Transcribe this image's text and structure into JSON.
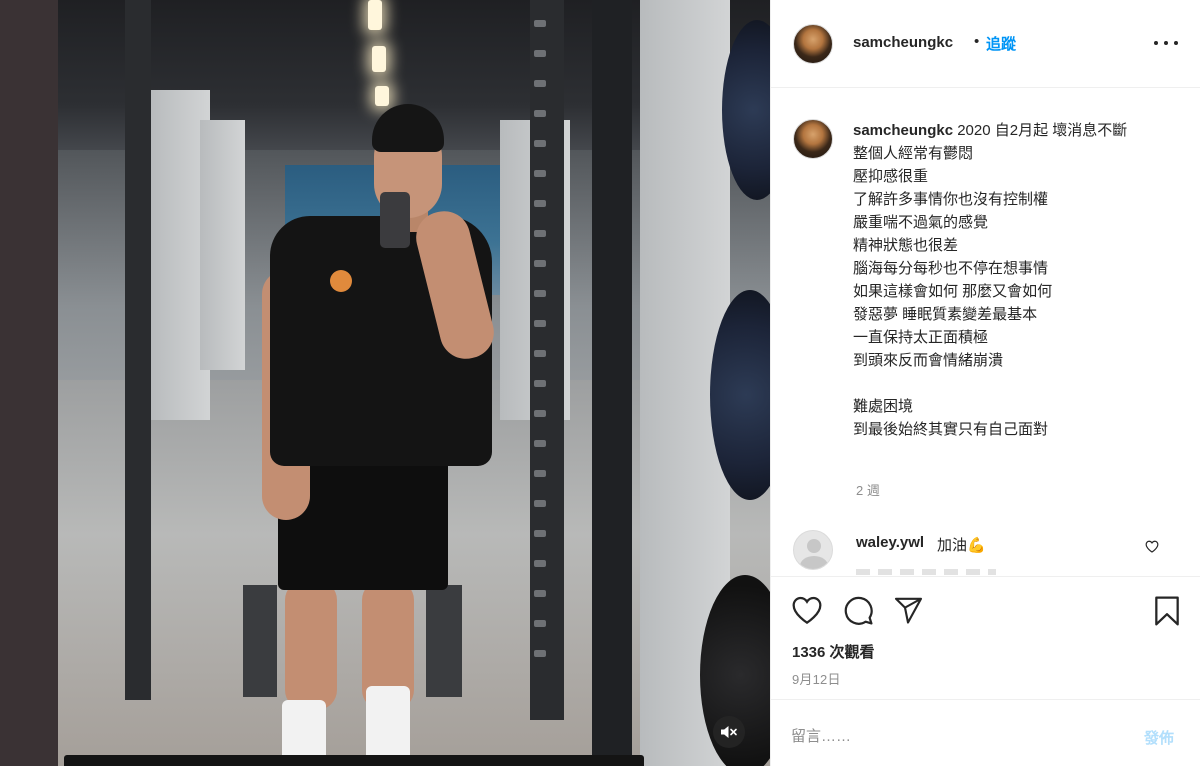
{
  "post": {
    "username": "samcheungkc",
    "separator": "•",
    "follow_label": "追蹤",
    "more_icon": "more-horizontal-icon"
  },
  "caption": {
    "username": "samcheungkc",
    "lines": [
      "2020 自2月起 壞消息不斷",
      "整個人經常有鬱悶",
      "壓抑感很重",
      "了解許多事情你也沒有控制權",
      "嚴重喘不過氣的感覺",
      "精神狀態也很差",
      "腦海每分每秒也不停在想事情",
      "如果這樣會如何 那麼又會如何",
      "發惡夢 睡眠質素變差最基本",
      "一直保持太正面積極",
      "到頭來反而會情緒崩潰",
      "",
      "難處困境",
      "到最後始終其實只有自己面對"
    ],
    "age": "2 週"
  },
  "comment": {
    "username": "waley.ywl",
    "text": "加油💪"
  },
  "footer": {
    "views": "1336 次觀看",
    "date": "9月12日",
    "add_comment_placeholder": "留言……",
    "post_label": "發佈"
  },
  "icons": {
    "like": "heart-icon",
    "comment": "comment-icon",
    "share": "send-icon",
    "save": "bookmark-icon",
    "mute": "speaker-muted-icon"
  },
  "colors": {
    "link_blue": "#0095f6",
    "post_disabled": "#b2dffc",
    "muted_text": "#8e8e8e",
    "divider": "#efefef"
  }
}
